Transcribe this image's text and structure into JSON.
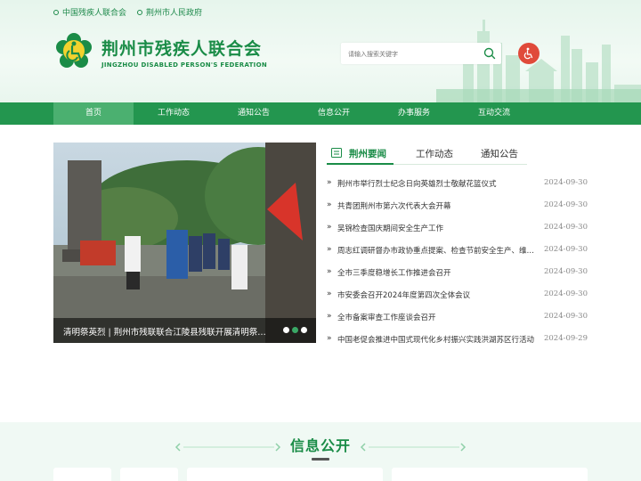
{
  "top_links": [
    "中国残疾人联合会",
    "荆州市人民政府"
  ],
  "site": {
    "title": "荆州市残疾人联合会",
    "subtitle": "JINGZHOU DISABLED PERSON'S FEDERATION"
  },
  "search": {
    "placeholder": "请输入搜索关键字"
  },
  "nav": [
    "首页",
    "工作动态",
    "通知公告",
    "信息公开",
    "办事服务",
    "互动交流"
  ],
  "carousel": {
    "caption": "清明祭英烈 | 荆州市残联联合江陵县残联开展清明祭英烈活动",
    "dot_count": 3,
    "active_dot": 2
  },
  "news": {
    "tabs": [
      "荆州要闻",
      "工作动态",
      "通知公告"
    ],
    "items": [
      {
        "title": "荆州市举行烈士纪念日向英雄烈士敬献花篮仪式",
        "date": "2024-09-30"
      },
      {
        "title": "共青团荆州市第六次代表大会开幕",
        "date": "2024-09-30"
      },
      {
        "title": "吴锦检查国庆期间安全生产工作",
        "date": "2024-09-30"
      },
      {
        "title": "周志红调研督办市政协重点提案、检查节前安全生产、维稳工作",
        "date": "2024-09-30"
      },
      {
        "title": "全市三季度稳增长工作推进会召开",
        "date": "2024-09-30"
      },
      {
        "title": "市安委会召开2024年度第四次全体会议",
        "date": "2024-09-30"
      },
      {
        "title": "全市备案审查工作座谈会召开",
        "date": "2024-09-30"
      },
      {
        "title": "中国老促会推进中国式现代化乡村振兴实践洪湖苏区行活动",
        "date": "2024-09-29"
      }
    ]
  },
  "info_section": {
    "title": "信息公开"
  },
  "colors": {
    "brand": "#1a8c47",
    "nav": "#23964f",
    "nav_active": "#4bb070",
    "accessibility": "#e04a3a"
  }
}
